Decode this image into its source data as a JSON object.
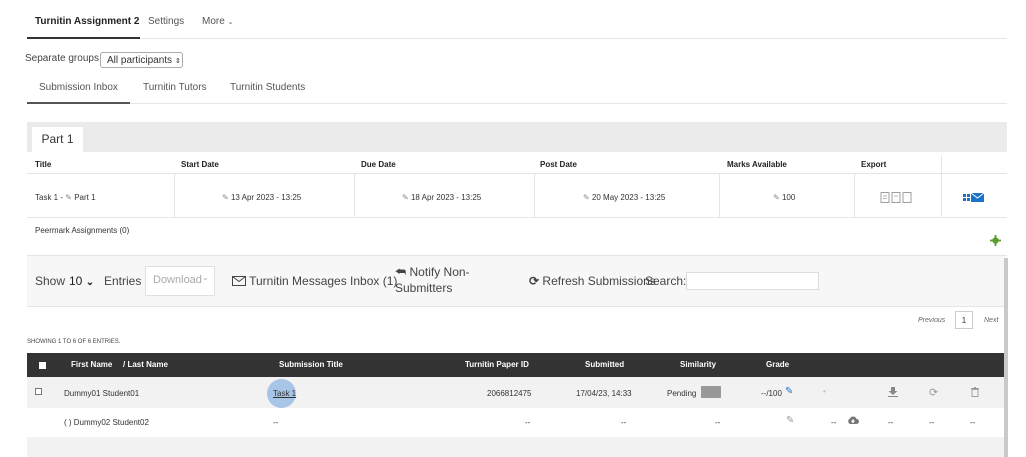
{
  "top_tabs": [
    {
      "label": "Turnitin Assignment 2"
    },
    {
      "label": "Settings"
    },
    {
      "label": "More"
    }
  ],
  "groups": {
    "label": "Separate groups",
    "selected": "All participants"
  },
  "inbox_tabs": [
    {
      "label": "Submission Inbox"
    },
    {
      "label": "Turnitin Tutors"
    },
    {
      "label": "Turnitin Students"
    }
  ],
  "part": {
    "tab_label": "Part 1",
    "headers": {
      "title": "Title",
      "start": "Start Date",
      "due": "Due Date",
      "post": "Post Date",
      "marks": "Marks Available",
      "export": "Export"
    },
    "row": {
      "title_prefix": "Task 1 -",
      "title_part": "Part 1",
      "start": "13 Apr 2023 - 13:25",
      "due": "18 Apr 2023 - 13:25",
      "post": "20 May 2023 - 13:25",
      "marks": "100"
    },
    "peermark": "Peermark Assignments (0)"
  },
  "controls": {
    "show": "Show",
    "entries_value": "10",
    "entries": "Entries",
    "download": "Download",
    "messages": "Turnitin Messages Inbox (1)",
    "notify_line1": "Notify Non-",
    "notify_line2": "Submitters",
    "refresh": "Refresh Submissions",
    "search": "Search:"
  },
  "pagination": {
    "previous": "Previous",
    "page": "1",
    "next": "Next"
  },
  "showing": "SHOWING 1 TO 6 OF 6 ENTRIES.",
  "table": {
    "headers": {
      "first_name": "First Name",
      "last_name": "/ Last Name",
      "title": "Submission Title",
      "paper_id": "Turnitin Paper ID",
      "submitted": "Submitted",
      "similarity": "Similarity",
      "grade": "Grade"
    },
    "rows": [
      {
        "name": "Dummy01 Student01",
        "title": "Task 1",
        "paper_id": "2066812475",
        "submitted": "17/04/23, 14:33",
        "similarity": "Pending",
        "grade": "--/100",
        "dot": "•"
      },
      {
        "name": "(  ) Dummy02 Student02",
        "title": "--",
        "paper_id": "--",
        "submitted": "--",
        "similarity": "--",
        "grade_dash": "--",
        "col_a": "--",
        "col_b": "--",
        "col_c": "--"
      }
    ]
  },
  "colors": {
    "header_dark": "#333333",
    "accent_blue": "#1a73c8",
    "green": "#5a9e2c",
    "highlight": "#8fb4e3"
  }
}
